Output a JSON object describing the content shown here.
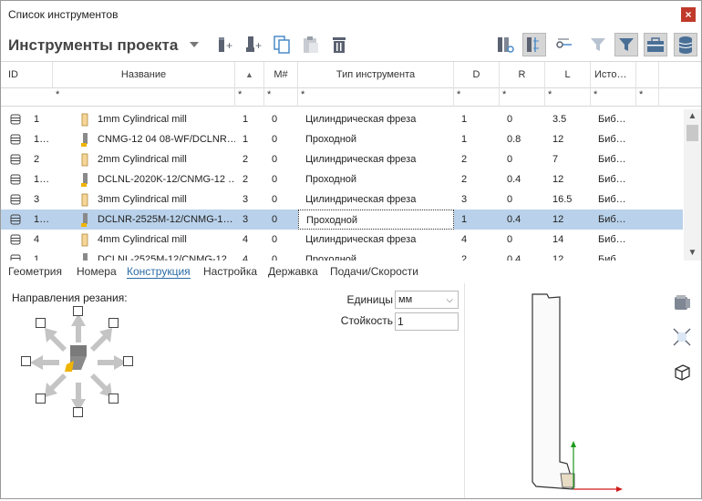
{
  "window": {
    "title": "Список инструментов",
    "close_label": "×"
  },
  "toolbar": {
    "project_title": "Инструменты проекта"
  },
  "grid": {
    "columns": [
      "ID",
      "Название",
      "▲",
      "M#",
      "Тип инструмента",
      "D",
      "R",
      "L",
      "Исто…"
    ],
    "filter_placeholder": "*",
    "rows": [
      {
        "id": "1",
        "name": "1mm Cylindrical mill",
        "num": "1",
        "m": "0",
        "type": "Цилиндрическая фреза",
        "d": "1",
        "r": "0",
        "l": "3.5",
        "src": "Биб…",
        "icon": "mill-icon",
        "selected": false
      },
      {
        "id": "1…",
        "name": "CNMG-12 04 08-WF/DCLNR…",
        "num": "1",
        "m": "0",
        "type": "Проходной",
        "d": "1",
        "r": "0.8",
        "l": "12",
        "src": "Биб…",
        "icon": "turning-tool-icon",
        "selected": false
      },
      {
        "id": "2",
        "name": "2mm Cylindrical mill",
        "num": "2",
        "m": "0",
        "type": "Цилиндрическая фреза",
        "d": "2",
        "r": "0",
        "l": "7",
        "src": "Биб…",
        "icon": "mill-icon",
        "selected": false
      },
      {
        "id": "1…",
        "name": "DCLNL-2020K-12/CNMG-12 …",
        "num": "2",
        "m": "0",
        "type": "Проходной",
        "d": "2",
        "r": "0.4",
        "l": "12",
        "src": "Биб…",
        "icon": "turning-tool-icon",
        "selected": false
      },
      {
        "id": "3",
        "name": "3mm Cylindrical mill",
        "num": "3",
        "m": "0",
        "type": "Цилиндрическая фреза",
        "d": "3",
        "r": "0",
        "l": "16.5",
        "src": "Биб…",
        "icon": "mill-icon",
        "selected": false
      },
      {
        "id": "1…",
        "name": "DCLNR-2525M-12/CNMG-1…",
        "num": "3",
        "m": "0",
        "type": "Проходной",
        "d": "1",
        "r": "0.4",
        "l": "12",
        "src": "Биб…",
        "icon": "turning-tool-icon",
        "selected": true
      },
      {
        "id": "4",
        "name": "4mm Cylindrical mill",
        "num": "4",
        "m": "0",
        "type": "Цилиндрическая фреза",
        "d": "4",
        "r": "0",
        "l": "14",
        "src": "Биб…",
        "icon": "mill-icon",
        "selected": false
      },
      {
        "id": "1…",
        "name": "DCLNL-2525M-12/CNMG-12",
        "num": "4",
        "m": "0",
        "type": "Проходной",
        "d": "2",
        "r": "0.4",
        "l": "12",
        "src": "Биб…",
        "icon": "turning-tool-icon",
        "selected": false
      }
    ]
  },
  "tabs": [
    "Геометрия",
    "Номера",
    "Конструкция",
    "Настройка",
    "Державка",
    "Подачи/Скорости"
  ],
  "active_tab": "Конструкция",
  "construction": {
    "cutting_directions_label": "Направления резания:",
    "units_label": "Единицы",
    "units_value": "мм",
    "durability_label": "Стойкость",
    "durability_value": "1"
  },
  "colors": {
    "accent": "#2a6aa5",
    "selection": "#b9d1ea",
    "insert": "#f0b400",
    "close": "#c0392b"
  }
}
